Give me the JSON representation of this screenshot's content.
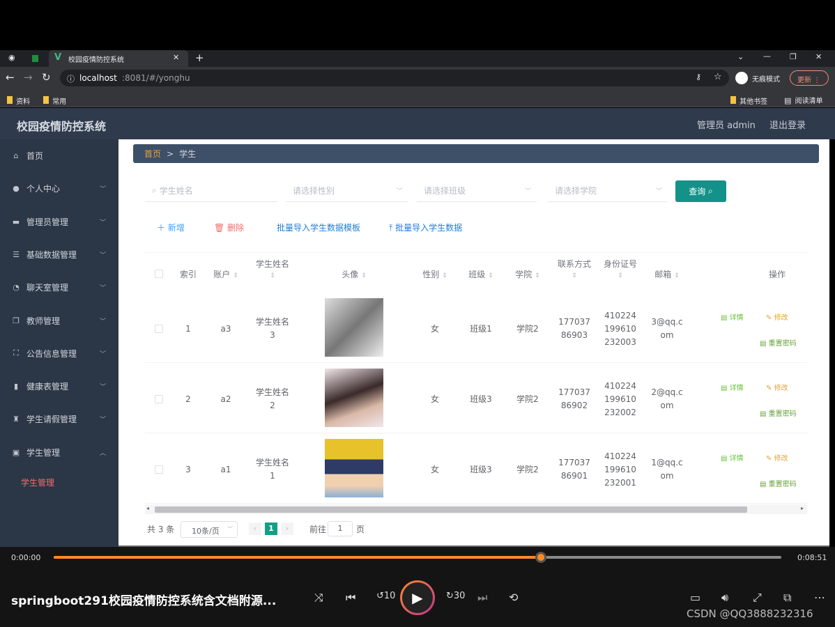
{
  "browser": {
    "tab_title": "校园疫情防控系统",
    "url_host": "localhost",
    "url_rest": ":8081/#/yonghu",
    "incognito": "无痕模式",
    "update": "更新",
    "bookmarks": [
      "资料",
      "常用"
    ],
    "other_bookmarks": "其他书签",
    "reading_list": "阅读清单"
  },
  "app": {
    "title": "校园疫情防控系统",
    "user": "管理员 admin",
    "logout": "退出登录"
  },
  "sidebar": {
    "items": [
      {
        "label": "首页",
        "icon": "home-icon"
      },
      {
        "label": "个人中心",
        "icon": "user-icon"
      },
      {
        "label": "管理员管理",
        "icon": "monitor-icon"
      },
      {
        "label": "基础数据管理",
        "icon": "list-icon"
      },
      {
        "label": "聊天室管理",
        "icon": "chat-icon"
      },
      {
        "label": "教师管理",
        "icon": "copy-icon"
      },
      {
        "label": "公告信息管理",
        "icon": "crop-icon"
      },
      {
        "label": "健康表管理",
        "icon": "bar-chart-icon"
      },
      {
        "label": "学生请假管理",
        "icon": "stamp-icon"
      },
      {
        "label": "学生管理",
        "icon": "picture-icon"
      }
    ],
    "sub_active": "学生管理",
    "accent": "#f56c6c"
  },
  "breadcrumb": {
    "home": "首页",
    "sep": ">",
    "current": "学生"
  },
  "filters": {
    "name_placeholder": "学生姓名",
    "gender_placeholder": "请选择性别",
    "class_placeholder": "请选择班级",
    "college_placeholder": "请选择学院",
    "query": "查询"
  },
  "actions": {
    "add": "新增",
    "delete": "删除",
    "template": "批量导入学生数据模板",
    "import": "批量导入学生数据"
  },
  "table": {
    "headers": [
      "索引",
      "账户",
      "学生姓名",
      "头像",
      "性别",
      "班级",
      "学院",
      "联系方式",
      "身份证号",
      "邮箱",
      "操作"
    ],
    "rows": [
      {
        "index": "1",
        "account": "a3",
        "name": "学生姓名3",
        "gender": "女",
        "class": "班级1",
        "college": "学院2",
        "phone": "17703786903",
        "idcard": "410224199610232003",
        "email": "3@qq.com"
      },
      {
        "index": "2",
        "account": "a2",
        "name": "学生姓名2",
        "gender": "女",
        "class": "班级3",
        "college": "学院2",
        "phone": "17703786902",
        "idcard": "410224199610232002",
        "email": "2@qq.com"
      },
      {
        "index": "3",
        "account": "a1",
        "name": "学生姓名1",
        "gender": "女",
        "class": "班级3",
        "college": "学院2",
        "phone": "17703786901",
        "idcard": "410224199610232001",
        "email": "1@qq.com"
      }
    ],
    "ops": {
      "detail": "详情",
      "edit": "修改",
      "reset": "重置密码"
    }
  },
  "pagination": {
    "total": "共 3 条",
    "page_size": "10条/页",
    "current": "1",
    "goto": "前往",
    "goto_value": "1",
    "page_unit": "页"
  },
  "player": {
    "elapsed": "0:00:00",
    "duration": "0:08:51",
    "progress": 0.67,
    "title": "springboot291校园疫情防控系统含文档附源...",
    "watermark": "CSDN @QQ3888232316",
    "accent": "#ff8a2a"
  }
}
